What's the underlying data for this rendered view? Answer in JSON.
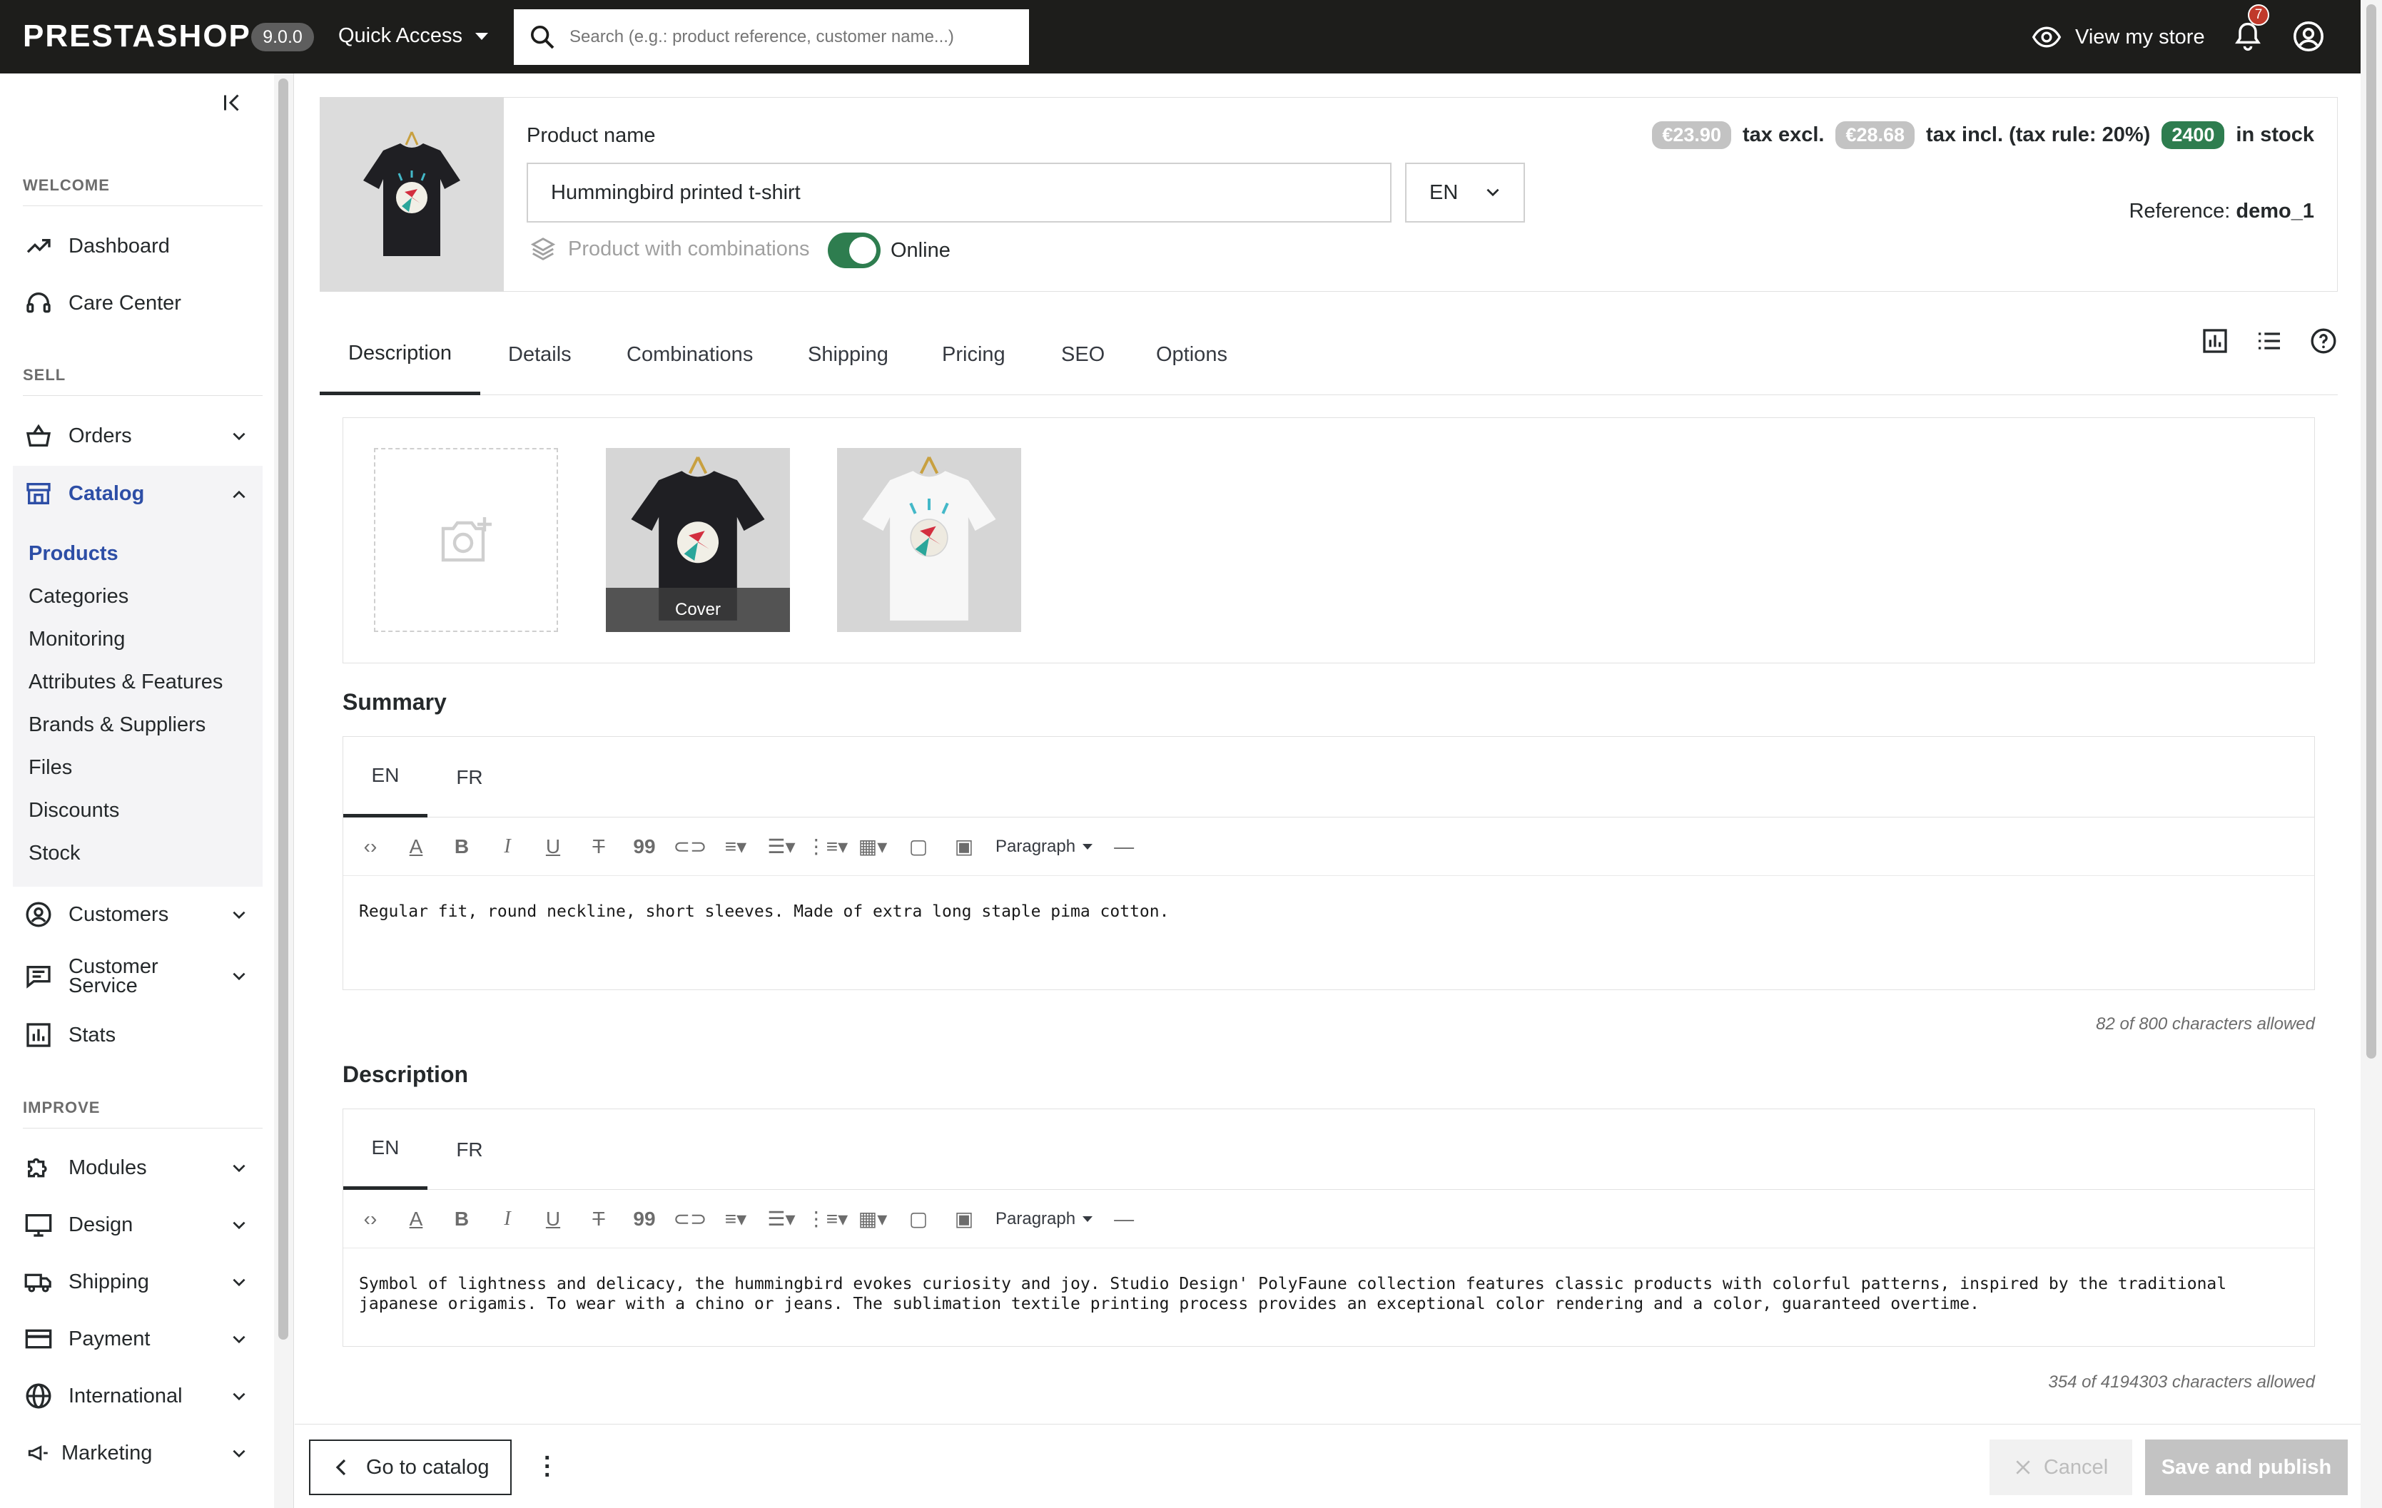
{
  "topbar": {
    "logo": "PRESTASHOP",
    "version": "9.0.0",
    "quick_access": "Quick Access",
    "search_placeholder": "Search (e.g.: product reference, customer name...)",
    "view_store": "View my store",
    "notifications_count": "7"
  },
  "sidebar": {
    "sections": {
      "welcome": "WELCOME",
      "sell": "SELL",
      "improve": "IMPROVE"
    },
    "dashboard": "Dashboard",
    "care_center": "Care Center",
    "orders": "Orders",
    "catalog": "Catalog",
    "catalog_items": [
      "Products",
      "Categories",
      "Monitoring",
      "Attributes & Features",
      "Brands & Suppliers",
      "Files",
      "Discounts",
      "Stock"
    ],
    "customers": "Customers",
    "customer_service": "Customer Service",
    "stats": "Stats",
    "modules": "Modules",
    "design": "Design",
    "shipping": "Shipping",
    "payment": "Payment",
    "international": "International",
    "marketing": "Marketing"
  },
  "product": {
    "name_label": "Product name",
    "name_value": "Hummingbird printed t-shirt",
    "lang": "EN",
    "combinations_label": "Product with combinations",
    "online_label": "Online",
    "online": true,
    "price_excl": "€23.90",
    "tax_excl_label": "tax excl.",
    "price_incl": "€28.68",
    "tax_incl_label": "tax incl. (tax rule: 20%)",
    "stock": "2400",
    "stock_label": "in stock",
    "reference_label": "Reference:",
    "reference_value": "demo_1"
  },
  "tabs": [
    "Description",
    "Details",
    "Combinations",
    "Shipping",
    "Pricing",
    "SEO",
    "Options"
  ],
  "images": {
    "cover_label": "Cover"
  },
  "summary": {
    "title": "Summary",
    "langs": [
      "EN",
      "FR"
    ],
    "format": "Paragraph",
    "text": "Regular fit, round neckline, short sleeves. Made of extra long staple pima cotton.",
    "count": "82 of 800 characters allowed"
  },
  "description": {
    "title": "Description",
    "langs": [
      "EN",
      "FR"
    ],
    "format": "Paragraph",
    "text": "Symbol of lightness and delicacy, the hummingbird evokes curiosity and joy. Studio Design' PolyFaune collection features classic products with colorful patterns, inspired by the traditional japanese origamis. To wear with a chino or jeans. The sublimation textile printing process provides an exceptional color rendering and a color, guaranteed overtime.",
    "count": "354 of 4194303 characters allowed"
  },
  "footer": {
    "go_catalog": "Go to catalog",
    "cancel": "Cancel",
    "save": "Save and publish"
  },
  "colors": {
    "topbar": "#1d1d1b",
    "catalog_active": "#2d4ea6",
    "toggle_on": "#2e7d4f",
    "stock_badge": "#2e7d4f"
  }
}
